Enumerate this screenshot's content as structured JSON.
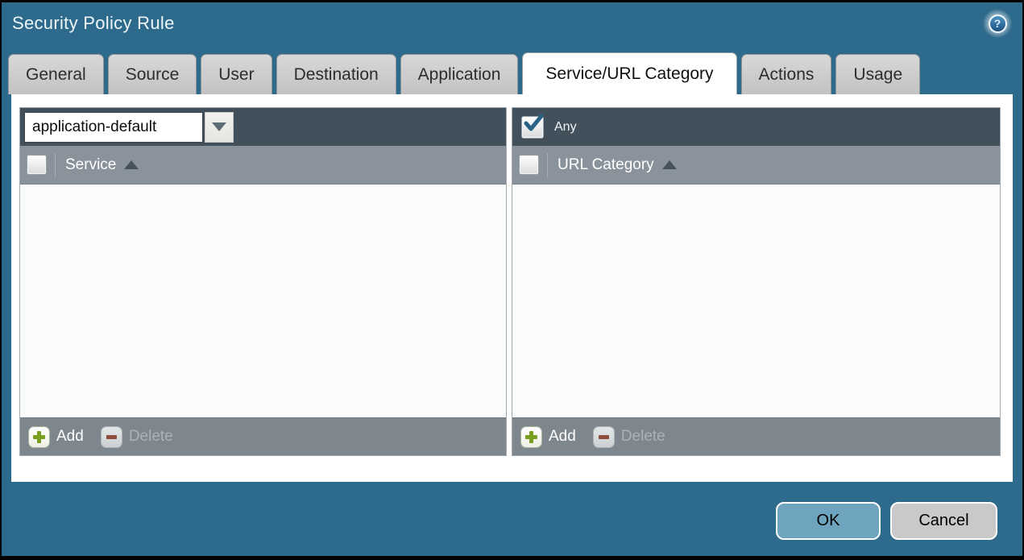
{
  "window": {
    "title": "Security Policy Rule",
    "help_icon_glyph": "?"
  },
  "tabs": [
    {
      "label": "General",
      "active": false
    },
    {
      "label": "Source",
      "active": false
    },
    {
      "label": "User",
      "active": false
    },
    {
      "label": "Destination",
      "active": false
    },
    {
      "label": "Application",
      "active": false
    },
    {
      "label": "Service/URL Category",
      "active": true
    },
    {
      "label": "Actions",
      "active": false
    },
    {
      "label": "Usage",
      "active": false
    }
  ],
  "service_panel": {
    "selector": {
      "value": "application-default"
    },
    "header": {
      "column": "Service",
      "sort": "ascending",
      "select_all_checked": false
    },
    "rows": [],
    "footer": {
      "add_label": "Add",
      "delete_label": "Delete",
      "delete_enabled": false
    }
  },
  "url_category_panel": {
    "any_checkbox": {
      "label": "Any",
      "checked": true
    },
    "header": {
      "column": "URL Category",
      "sort": "ascending",
      "select_all_checked": false
    },
    "rows": [],
    "footer": {
      "add_label": "Add",
      "delete_label": "Delete",
      "delete_enabled": false
    }
  },
  "dialog_buttons": {
    "ok_label": "OK",
    "cancel_label": "Cancel"
  },
  "colors": {
    "titlebar_teal": "#2e6a8b",
    "panel_toolbar_slate": "#41505a",
    "panel_header_gray": "#8a939b",
    "panel_footer_gray": "#7e878e",
    "ok_button_blue": "#6ea4bd",
    "cancel_button_gray": "#c9c9c9",
    "add_plus_green": "#7a9f1e",
    "delete_minus_red": "#8e4b3a",
    "checkmark_blue": "#2a6187"
  }
}
